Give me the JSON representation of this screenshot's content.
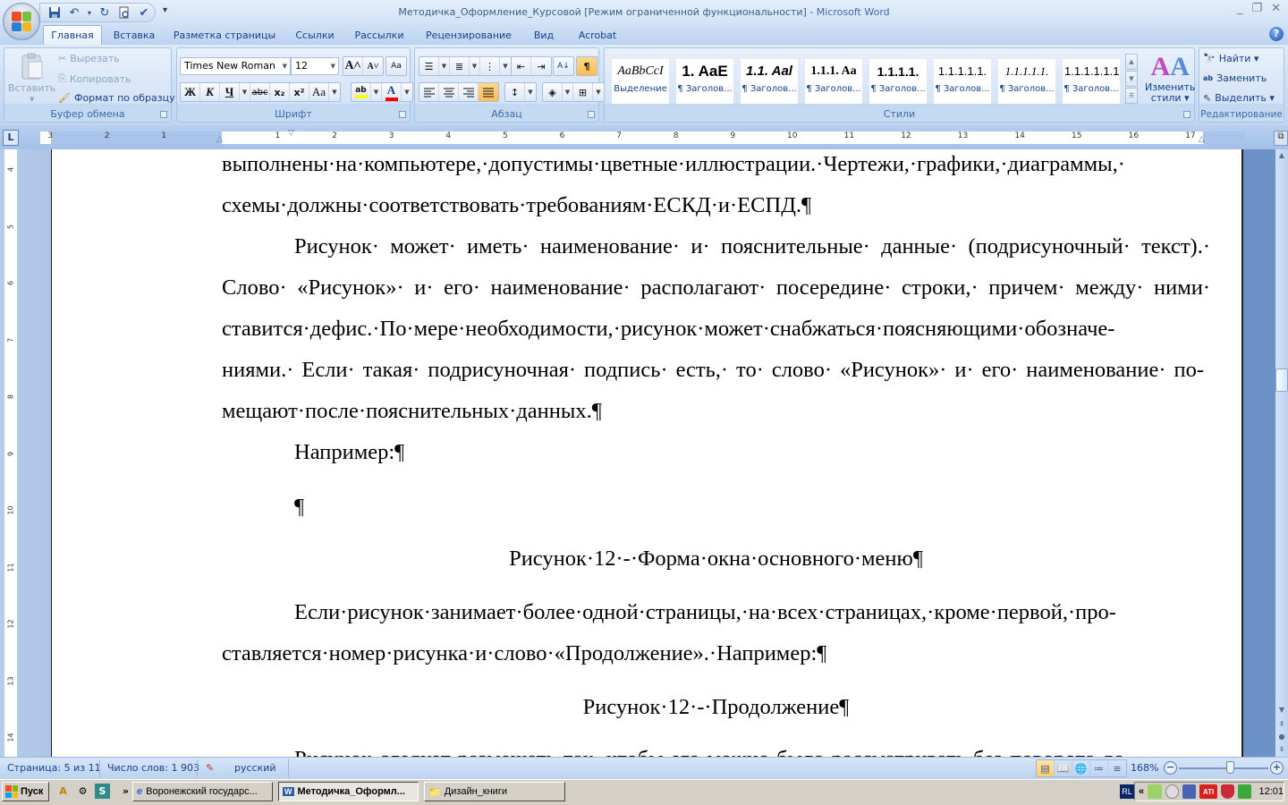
{
  "window": {
    "title_doc": "Методичка_Оформление_Курсовой [Режим ограниченной функциональности]",
    "title_sep": " - ",
    "title_app": "Microsoft Word",
    "controls": {
      "minimize": "_",
      "restore": "❐",
      "close": "✕"
    }
  },
  "qat": {
    "save": "💾",
    "undo": "↶",
    "undo_dd": "▾",
    "redo": "↻",
    "print_preview": "🔍",
    "spelling": "✔",
    "customize": "▾"
  },
  "tabs": [
    {
      "label": "Главная",
      "active": true
    },
    {
      "label": "Вставка"
    },
    {
      "label": "Разметка страницы"
    },
    {
      "label": "Ссылки"
    },
    {
      "label": "Рассылки"
    },
    {
      "label": "Рецензирование"
    },
    {
      "label": "Вид"
    },
    {
      "label": "Acrobat"
    }
  ],
  "help": "?",
  "ribbon": {
    "clipboard": {
      "label": "Буфер обмена",
      "paste": "Вставить",
      "cut": "Вырезать",
      "copy": "Копировать",
      "format_painter": "Формат по образцу"
    },
    "font": {
      "label": "Шрифт",
      "font_name": "Times New Roman",
      "font_size": "12",
      "grow": "A˄",
      "shrink": "A˅",
      "clear": "Aa",
      "bold": "Ж",
      "italic": "К",
      "underline": "Ч",
      "strike": "abc",
      "subscript": "x₂",
      "superscript": "x²",
      "case": "Aa",
      "highlight": "ab",
      "font_color": "A",
      "highlight_color": "#ffff00",
      "font_color_value": "#ff0000"
    },
    "paragraph": {
      "label": "Абзац",
      "show_marks": "¶",
      "sort": "А↓"
    },
    "styles": {
      "label": "Стили",
      "items": [
        {
          "preview": "AaBbCcI",
          "name": "Выделение"
        },
        {
          "preview": "1. AaE",
          "name": "¶ Заголов..."
        },
        {
          "preview": "1.1. Aal",
          "name": "¶ Заголов..."
        },
        {
          "preview": "1.1.1. Aa",
          "name": "¶ Заголов..."
        },
        {
          "preview": "1.1.1.1.",
          "name": "¶ Заголов..."
        },
        {
          "preview": "1.1.1.1.1.",
          "name": "¶ Заголов..."
        },
        {
          "preview": "1.1.1.1.1.",
          "name": "¶ Заголов..."
        },
        {
          "preview": "1.1.1.1.1.1",
          "name": "¶ Заголов..."
        }
      ],
      "change_styles_1": "Изменить",
      "change_styles_2": "стили ▾"
    },
    "editing": {
      "label": "Редактирование",
      "find": "Найти ▾",
      "replace": "Заменить",
      "select": "Выделить ▾"
    }
  },
  "ruler": {
    "tab_selector": "L",
    "h_ticks": [
      "3",
      "2",
      "1",
      "1",
      "2",
      "3",
      "4",
      "5",
      "6",
      "7",
      "8",
      "9",
      "10",
      "11",
      "12",
      "13",
      "14",
      "15",
      "16",
      "17"
    ],
    "v_ticks": [
      "4",
      "5",
      "6",
      "7",
      "8",
      "9",
      "10",
      "11",
      "12",
      "13",
      "14"
    ]
  },
  "document": {
    "paragraphs": [
      "выполнены·на·компьютере,·допустимы·цветные·иллюстрации.·Чертежи,·графики,·диаграммы,·",
      "схемы·должны·соответствовать·требованиям·ЕСКД·и·ЕСПД.¶",
      "Рисунок· может· иметь· наименование· и· пояснительные· данные· (подрисуночный· текст).·",
      "Слово· «Рисунок»· и· его· наименование· располагают· посередине· строки,· причем· между· ними·",
      "ставится·дефис.·По·мере·необходимости,·рисунок·может·снабжаться·поясняющими·обозначе-",
      "ниями.· Если· такая· подрисуночная· подпись· есть,· то· слово· «Рисунок»· и· его· наименование· по-",
      "мещают·после·пояснительных·данных.¶",
      "Например:¶",
      "¶",
      "Рисунок·12·-·Форма·окна·основного·меню¶",
      "Если·рисунок·занимает·более·одной·страницы,·на·всех·страницах,·кроме·первой,·про-",
      "ставляется·номер·рисунка·и·слово·«Продолжение».·Например:¶",
      "Рисунок·12·-·Продолжение¶",
      "Рисунок·следует·размещать·так,·чтобы·его·можно·было·рассматривать·без·поворота·до-"
    ]
  },
  "statusbar": {
    "page": "Страница: 5 из 11",
    "words": "Число слов: 1 903",
    "proof_icon": "✎",
    "language": "русский",
    "zoom": "168%",
    "zoom_out": "−",
    "zoom_in": "+",
    "zoom_percent": 168
  },
  "taskbar": {
    "start": "Пуск",
    "quick_launch": [
      "A",
      "⚙",
      "S"
    ],
    "chevron": "»",
    "tasks": [
      {
        "label": "Воронежский государс...",
        "icon": "e",
        "active": false
      },
      {
        "label": "Методичка_Оформл...",
        "icon": "W",
        "active": true
      },
      {
        "label": "Дизайн_книги",
        "icon": "📁",
        "active": false
      }
    ],
    "lang": "RL",
    "tray_chevron": "«",
    "clock": "12:01",
    "tray_ati": "ATI"
  }
}
